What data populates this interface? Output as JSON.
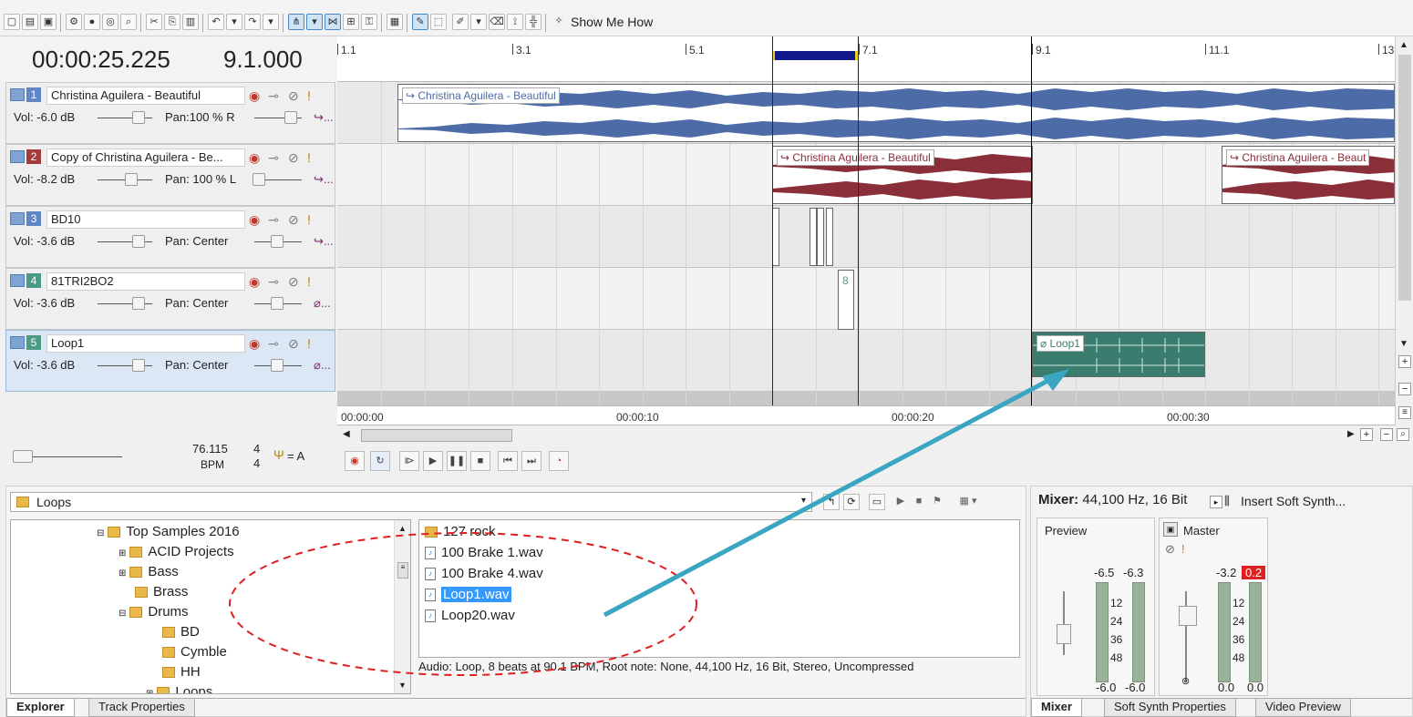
{
  "toolbar": {
    "show_me_how": "Show Me How"
  },
  "transport_readout": {
    "time": "00:00:25.225",
    "measure": "9.1.000"
  },
  "ruler": {
    "labels": [
      "1.1",
      "3.1",
      "5.1",
      "7.1",
      "9.1",
      "11.1",
      "13"
    ]
  },
  "tracks": [
    {
      "num": "1",
      "name": "Christina Aguilera - Beautiful",
      "vol": "Vol:  -6.0 dB",
      "pan": "Pan:100 % R",
      "more": "↪..."
    },
    {
      "num": "2",
      "name": "Copy of Christina Aguilera - Be...",
      "vol": "Vol:  -8.2 dB",
      "pan": "Pan: 100 % L",
      "more": "↪..."
    },
    {
      "num": "3",
      "name": "BD10",
      "vol": "Vol:  -3.6 dB",
      "pan": "Pan:  Center",
      "more": "↪..."
    },
    {
      "num": "4",
      "name": "81TRI2BO2",
      "vol": "Vol:  -3.6 dB",
      "pan": "Pan:  Center",
      "more": "⌀..."
    },
    {
      "num": "5",
      "name": "Loop1",
      "vol": "Vol:  -3.6 dB",
      "pan": "Pan:  Center",
      "more": "⌀..."
    }
  ],
  "events": {
    "track1": "↪ Christina Aguilera - Beautiful",
    "track2a": "↪ Christina Aguilera - Beautiful",
    "track2b": "↪ Christina Aguilera - Beaut",
    "track4_badge": "8",
    "track5": "⌀ Loop1"
  },
  "time_ruler": {
    "labels": [
      "00:00:00",
      "00:00:10",
      "00:00:20",
      "00:00:30"
    ]
  },
  "tempo": {
    "bpm": "76.115",
    "bpm_label": "BPM",
    "sig_top": "4",
    "sig_bottom": "4",
    "key": "= A"
  },
  "explorer": {
    "path": "Loops",
    "tree": [
      "Top Samples 2016",
      "ACID Projects",
      "Bass",
      "Brass",
      "Drums",
      "BD",
      "Cymble",
      "HH",
      "Loops"
    ],
    "files": [
      "127 rock",
      "100 Brake 1.wav",
      "100 Brake 4.wav",
      "Loop1.wav",
      "Loop20.wav"
    ],
    "info": "Audio: Loop, 8 beats at 90.1 BPM, Root note: None, 44,100 Hz, 16 Bit, Stereo, Uncompressed",
    "tabs": [
      "Explorer",
      "Track Properties"
    ]
  },
  "mixer": {
    "title_bold": "Mixer:",
    "title_rest": " 44,100 Hz, 16 Bit",
    "insert": "Insert Soft Synth...",
    "preview_label": "Preview",
    "master_label": "Master",
    "preview_peaks": [
      "-6.5",
      "-6.3"
    ],
    "master_peaks": [
      "-3.2",
      "0.2"
    ],
    "scale": [
      "12",
      "24",
      "36",
      "48"
    ],
    "preview_vals": [
      "-6.0",
      "-6.0"
    ],
    "master_vals": [
      "0.0",
      "0.0"
    ],
    "tabs": [
      "Mixer",
      "Soft Synth Properties",
      "Video Preview"
    ]
  }
}
